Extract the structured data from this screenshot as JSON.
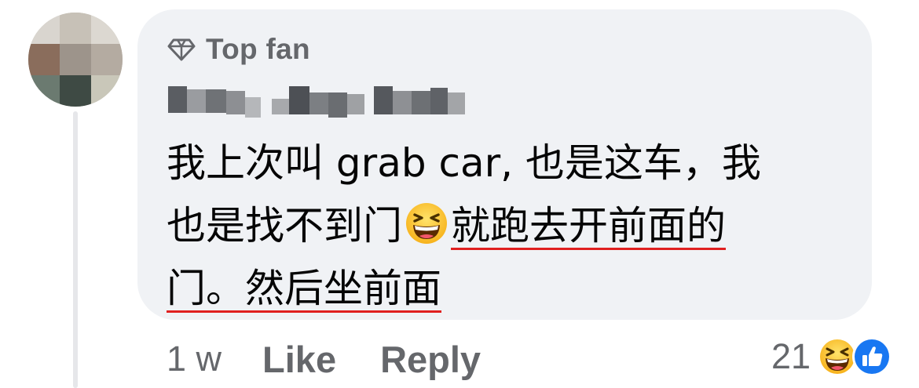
{
  "comment": {
    "badge": {
      "label": "Top fan",
      "icon": "diamond-icon"
    },
    "author": {
      "name": "",
      "blurred": true
    },
    "text_lines": [
      {
        "segments": [
          {
            "text": "我上次叫 grab car, 也是这车，我",
            "underline": false
          }
        ]
      },
      {
        "segments": [
          {
            "text": "也是找不到门",
            "underline": false
          },
          {
            "emoji": "laughing-emoji"
          },
          {
            "text": "就跑去开前面的",
            "underline": true
          }
        ]
      },
      {
        "segments": [
          {
            "text": "门。然后坐前面",
            "underline": true
          }
        ]
      }
    ],
    "underline_color": "#e02020"
  },
  "footer": {
    "time": "1 w",
    "like_label": "Like",
    "reply_label": "Reply"
  },
  "reactions": {
    "count": "21",
    "icons": [
      "laughing-emoji",
      "like-thumb-icon"
    ]
  },
  "colors": {
    "bubble": "#f0f2f5",
    "meta_text": "#65676b",
    "body_text": "#050505",
    "like_blue": "#1877f2"
  }
}
